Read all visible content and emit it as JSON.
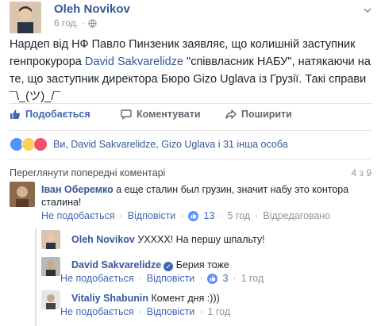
{
  "post": {
    "author": "Oleh Novikov",
    "time": "6 год.",
    "text_before_mention1": "Нардеп від НФ Павло Пинзеник заявляє, що колишній заступник генпрокурора ",
    "mention1": "David Sakvarelidze",
    "text_after_mention1": " \"співвласник НАБУ\", натякаючи на те, що заступник директора Бюро Gizo Uglava із Грузії. Такі справи ¯\\_(ツ)_/¯"
  },
  "actions": {
    "like": "Подобається",
    "comment": "Коментувати",
    "share": "Поширити"
  },
  "reactions": {
    "names": "Ви, David Sakvarelidze, Gizo Uglava і 31 інша особа"
  },
  "comments_header": {
    "previous": "Переглянути попередні коментарі",
    "count": "4 з 9"
  },
  "comments": [
    {
      "author": "Іван Оберемко",
      "text": " а еще сталин был грузин, значит набу это контора сталина!",
      "dislike": "Не подобається",
      "reply": "Відповісти",
      "likes": "13",
      "time": "5 год",
      "edited": "Відредаговано"
    },
    {
      "author": "Oleh Novikov",
      "text": " УХХХХ! На першу шпальту!"
    },
    {
      "author": "David Sakvarelidze",
      "text": " Берия тоже",
      "dislike": "Не подобається",
      "reply": "Відповісти",
      "likes": "3",
      "time": "1 год"
    },
    {
      "author": "Vitaliy Shabunin",
      "text": " Комент дня :)))",
      "dislike": "Не подобається",
      "reply": "Відповісти",
      "time": "1 год"
    }
  ],
  "colors": {
    "link": "#365899",
    "action_blue": "#4267b2",
    "meta_gray": "#90949c",
    "like_reaction": "#5890ff"
  },
  "icons": [
    "globe-icon",
    "chevron-down-icon",
    "like-icon",
    "comment-icon",
    "share-icon",
    "verified-icon"
  ]
}
